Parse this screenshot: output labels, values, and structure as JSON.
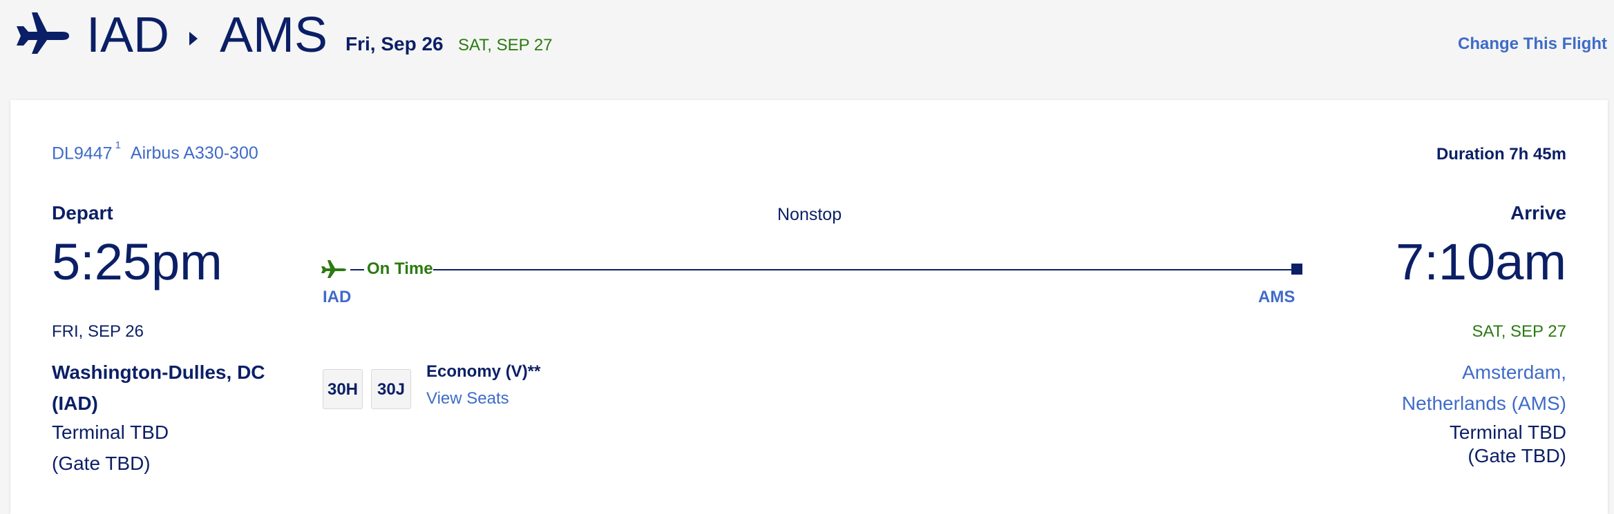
{
  "header": {
    "origin": "IAD",
    "destination": "AMS",
    "date": "Fri, Sep 26",
    "arrival_date": "SAT, SEP 27",
    "change_flight_label": "Change This Flight"
  },
  "flight": {
    "number": "DL9447",
    "footnote": "1",
    "aircraft": "Airbus A330-300",
    "duration": "Duration 7h 45m",
    "stops": "Nonstop",
    "status": "On Time"
  },
  "depart": {
    "label": "Depart",
    "time": "5:25pm",
    "code": "IAD",
    "date": "FRI, SEP 26",
    "city_line1": "Washington-Dulles, DC",
    "city_line2": "(IAD)",
    "terminal": "Terminal TBD",
    "gate": "(Gate TBD)"
  },
  "arrive": {
    "label": "Arrive",
    "time": "7:10am",
    "code": "AMS",
    "date": "SAT, SEP 27",
    "city_line1": "Amsterdam,",
    "city_line2": "Netherlands (AMS)",
    "terminal": "Terminal TBD",
    "gate": "(Gate TBD)"
  },
  "seats": {
    "assigned": [
      "30H",
      "30J"
    ],
    "cabin": "Economy (V)**",
    "view_seats_label": "View Seats"
  },
  "colors": {
    "navy": "#0b1f66",
    "link_blue": "#3f6bc8",
    "status_green": "#2c7a12",
    "background": "#f5f5f5"
  },
  "icons": {
    "header_plane": "airplane-icon",
    "route_arrow": "caret-right-icon",
    "status_plane": "airplane-icon",
    "line_end": "square-marker-icon"
  }
}
